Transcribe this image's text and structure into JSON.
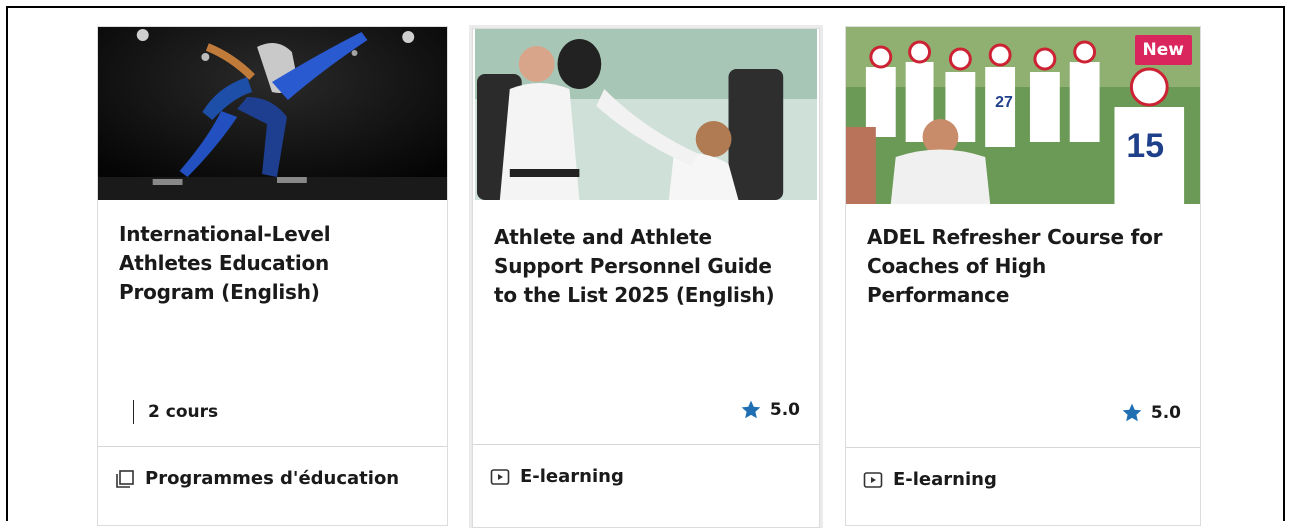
{
  "cards": [
    {
      "title": "International-Level Athletes Education Program (English)",
      "meta": "2 cours",
      "type_label": "Programmes d'éducation",
      "type_icon": "stack-icon",
      "image": "speed-skater-photo"
    },
    {
      "title": "Athlete and Athlete Support Personnel Guide to the List 2025 (English)",
      "rating": "5.0",
      "type_label": "E-learning",
      "type_icon": "play-icon",
      "image": "martial-arts-photo"
    },
    {
      "title": "ADEL Refresher Course for Coaches of High Performance",
      "rating": "5.0",
      "badge": "New",
      "type_label": "E-learning",
      "type_icon": "play-icon",
      "image": "lacrosse-team-photo"
    }
  ],
  "colors": {
    "star": "#1f6fb2",
    "badge": "#d9265c",
    "text": "#1a1a1a"
  }
}
